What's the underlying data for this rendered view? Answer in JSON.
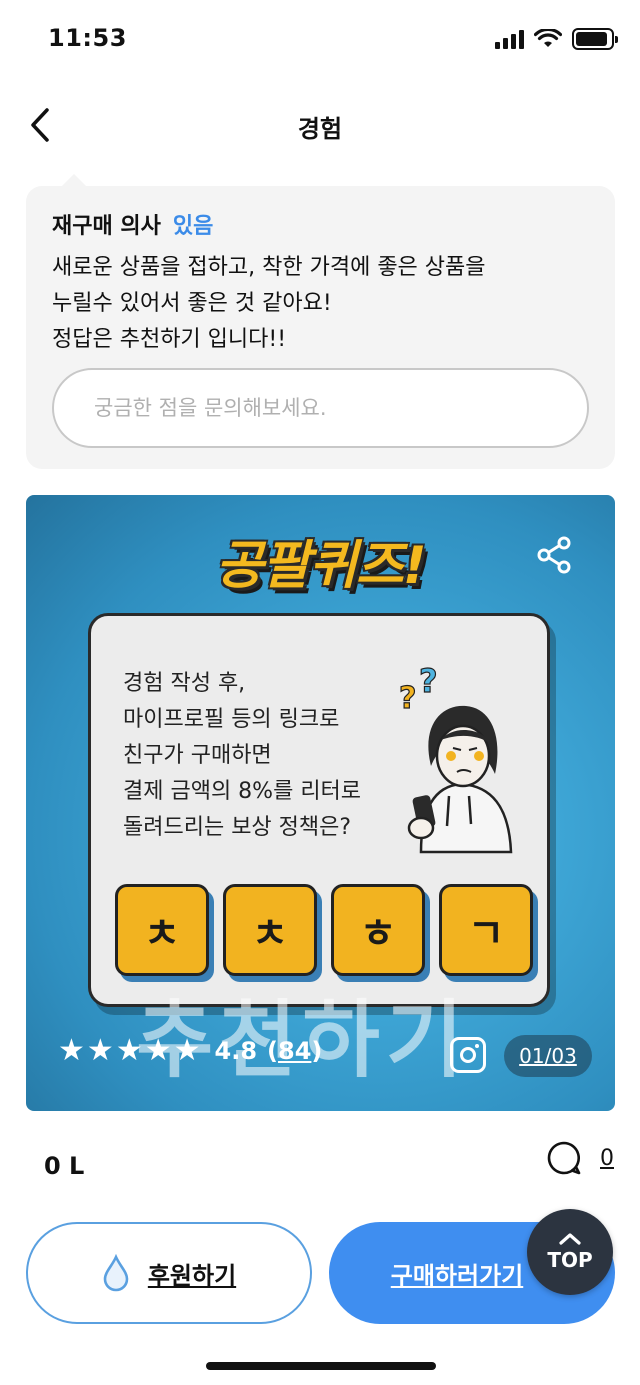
{
  "status_bar": {
    "time": "11:53",
    "icons": [
      "signal-icon",
      "wifi-icon",
      "battery-icon"
    ],
    "battery_level": 0.9
  },
  "nav": {
    "title": "경험",
    "back_icon": "chevron-left-icon"
  },
  "review": {
    "rebuy_label": "재구매 의사",
    "rebuy_value": "있음",
    "lines": [
      "새로운 상품을 접하고, 착한 가격에 좋은 상품을",
      "누릴수 있어서 좋은 것 같아요!",
      "정답은 추천하기 입니다!!"
    ],
    "input_placeholder": "궁금한 점을 문의해보세요.",
    "input_value": ""
  },
  "image_card": {
    "title": "공팔퀴즈!",
    "question_lines": [
      "경험 작성 후,",
      "마이프로필 등의 링크로",
      "친구가 구매하면",
      "결제 금액의 8%를 리터로",
      "돌려드리는 보상 정책은?"
    ],
    "tiles": [
      "ㅊ",
      "ㅊ",
      "ㅎ",
      "ㄱ"
    ],
    "answer_overlay": "추천하기",
    "rating": {
      "stars": 5,
      "value": "4.8",
      "count_open": "(",
      "count": "84",
      "count_close": ")"
    },
    "page_counter": "01/03",
    "colors": {
      "background": "#3ea6d6",
      "tile": "#f2b320",
      "title": "#f4b91f"
    }
  },
  "meta": {
    "likes": "0 L",
    "comments": "0"
  },
  "actions": {
    "sponsor_label": "후원하기",
    "buy_label": "구매하러가기",
    "top_label": "TOP"
  },
  "colors": {
    "accent": "#3f8ef0",
    "rebuy_value": "#3b8be8",
    "top_button": "#2c3440"
  }
}
